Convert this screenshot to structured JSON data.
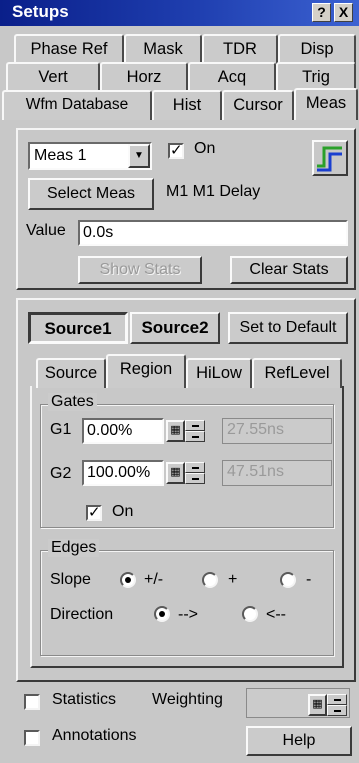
{
  "window": {
    "title": "Setups",
    "help_glyph": "?",
    "close_glyph": "X"
  },
  "tabs": {
    "row1": [
      "Phase Ref",
      "Mask",
      "TDR",
      "Disp"
    ],
    "row2": [
      "Vert",
      "Horz",
      "Acq",
      "Trig"
    ],
    "row3": [
      "Wfm Database",
      "Hist",
      "Cursor",
      "Meas"
    ],
    "active": "Meas"
  },
  "meas": {
    "selected": "Meas 1",
    "on_label": "On",
    "on_checked": true,
    "select_meas_label": "Select Meas",
    "description": "M1 M1 Delay",
    "value_label": "Value",
    "value": "0.0s",
    "show_stats_label": "Show Stats",
    "clear_stats_label": "Clear Stats"
  },
  "source_panel": {
    "source1_label": "Source1",
    "source2_label": "Source2",
    "set_default_label": "Set to Default",
    "subtabs": [
      "Source",
      "Region",
      "HiLow",
      "RefLevel"
    ],
    "active_subtab": "Region"
  },
  "gates": {
    "group_label": "Gates",
    "g1_label": "G1",
    "g1_value": "0.00%",
    "g1_time": "27.55ns",
    "g2_label": "G2",
    "g2_value": "100.00%",
    "g2_time": "47.51ns",
    "on_label": "On",
    "on_checked": true,
    "keypad_glyph": "▦"
  },
  "edges": {
    "group_label": "Edges",
    "slope_label": "Slope",
    "slope_options": [
      "+/-",
      "+",
      "-"
    ],
    "slope_selected": "+/-",
    "direction_label": "Direction",
    "direction_options": [
      "-->",
      "<--"
    ],
    "direction_selected": "-->"
  },
  "footer": {
    "statistics_label": "Statistics",
    "statistics_checked": false,
    "weighting_label": "Weighting",
    "weighting_value": "",
    "annotations_label": "Annotations",
    "annotations_checked": false,
    "help_label": "Help"
  },
  "colors": {
    "title_bar": "#1f3fb0",
    "icon_green": "#2aa02a",
    "icon_blue": "#1a3fd0"
  }
}
